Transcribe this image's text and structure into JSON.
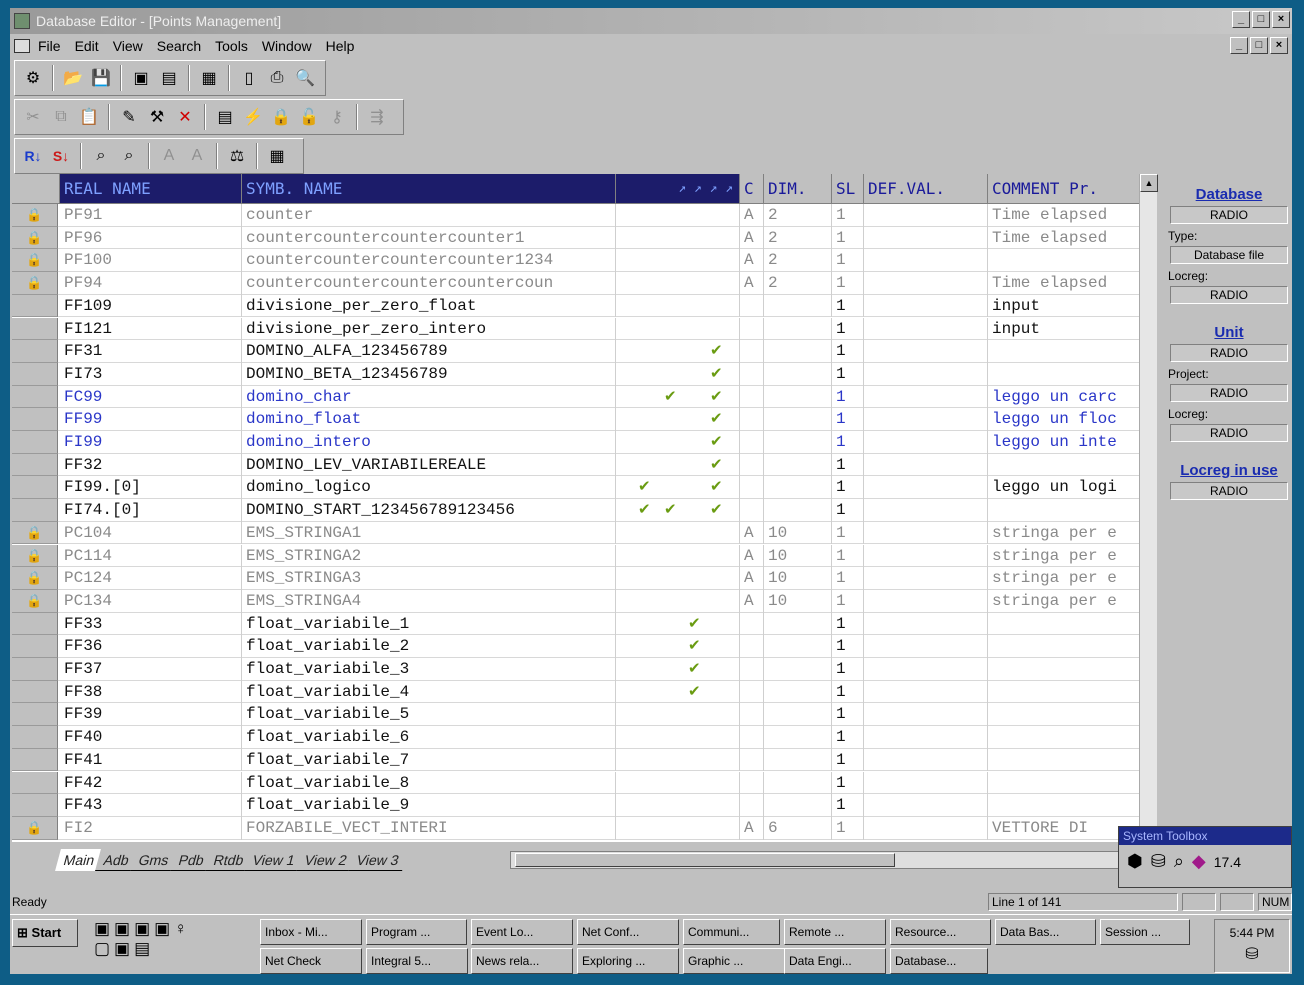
{
  "window": {
    "title": "Database Editor - [Points Management]",
    "buttons": [
      "_",
      "□",
      "×"
    ]
  },
  "menu": [
    "File",
    "Edit",
    "View",
    "Search",
    "Tools",
    "Window",
    "Help"
  ],
  "columns": {
    "real_name": "REAL NAME",
    "symb_name": "SYMB. NAME",
    "flags": "↗ ↗ ↗ ↗",
    "c": "C",
    "dim": "DIM.",
    "sl": "SL",
    "def_val": "DEF.VAL.",
    "comment": "COMMENT Pr."
  },
  "rows": [
    {
      "real": "PF91",
      "symb": "counter",
      "c": "A",
      "dim": "2",
      "sl": "1",
      "comment": "Time elapsed",
      "style": "gray",
      "rowicon": true
    },
    {
      "real": "PF96",
      "symb": "countercountercountercounter1",
      "c": "A",
      "dim": "2",
      "sl": "1",
      "comment": "Time elapsed",
      "style": "gray",
      "rowicon": true
    },
    {
      "real": "PF100",
      "symb": "countercountercountercounter1234",
      "c": "A",
      "dim": "2",
      "sl": "1",
      "comment": "",
      "style": "gray",
      "rowicon": true
    },
    {
      "real": "PF94",
      "symb": "countercountercountercountercoun",
      "c": "A",
      "dim": "2",
      "sl": "1",
      "comment": "Time elapsed",
      "style": "gray",
      "rowicon": true
    },
    {
      "real": "FF109",
      "symb": "divisione_per_zero_float",
      "c": "",
      "dim": "",
      "sl": "1",
      "comment": "input",
      "style": "blk"
    },
    {
      "real": "FI121",
      "symb": "divisione_per_zero_intero",
      "c": "",
      "dim": "",
      "sl": "1",
      "comment": "input",
      "style": "blk"
    },
    {
      "real": "FF31",
      "symb": "DOMINO_ALFA_123456789",
      "c": "",
      "dim": "",
      "sl": "1",
      "comment": "",
      "style": "blk",
      "checks": [
        4
      ]
    },
    {
      "real": "FI73",
      "symb": "DOMINO_BETA_123456789",
      "c": "",
      "dim": "",
      "sl": "1",
      "comment": "",
      "style": "blk",
      "checks": [
        4
      ]
    },
    {
      "real": "FC99",
      "symb": "domino_char",
      "c": "",
      "dim": "",
      "sl": "1",
      "comment": "leggo un carc",
      "style": "blue",
      "checks": [
        2,
        4
      ]
    },
    {
      "real": "FF99",
      "symb": "domino_float",
      "c": "",
      "dim": "",
      "sl": "1",
      "comment": "leggo un floc",
      "style": "blue",
      "checks": [
        4
      ]
    },
    {
      "real": "FI99",
      "symb": "domino_intero",
      "c": "",
      "dim": "",
      "sl": "1",
      "comment": "leggo un inte",
      "style": "blue",
      "checks": [
        4
      ]
    },
    {
      "real": "FF32",
      "symb": "DOMINO_LEV_VARIABILEREALE",
      "c": "",
      "dim": "",
      "sl": "1",
      "comment": "",
      "style": "blk",
      "checks": [
        4
      ]
    },
    {
      "real": "FI99.[0]",
      "symb": "domino_logico",
      "c": "",
      "dim": "",
      "sl": "1",
      "comment": "leggo un logi",
      "style": "blk",
      "checks": [
        1,
        4
      ]
    },
    {
      "real": "FI74.[0]",
      "symb": "DOMINO_START_123456789123456",
      "c": "",
      "dim": "",
      "sl": "1",
      "comment": "",
      "style": "blk",
      "checks": [
        1,
        2,
        4
      ]
    },
    {
      "real": "PC104",
      "symb": "EMS_STRINGA1",
      "c": "A",
      "dim": "10",
      "sl": "1",
      "comment": "stringa per e",
      "style": "gray",
      "rowicon": true
    },
    {
      "real": "PC114",
      "symb": "EMS_STRINGA2",
      "c": "A",
      "dim": "10",
      "sl": "1",
      "comment": "stringa per e",
      "style": "gray",
      "rowicon": true
    },
    {
      "real": "PC124",
      "symb": "EMS_STRINGA3",
      "c": "A",
      "dim": "10",
      "sl": "1",
      "comment": "stringa per e",
      "style": "gray",
      "rowicon": true
    },
    {
      "real": "PC134",
      "symb": "EMS_STRINGA4",
      "c": "A",
      "dim": "10",
      "sl": "1",
      "comment": "stringa per e",
      "style": "gray",
      "rowicon": true
    },
    {
      "real": "FF33",
      "symb": "float_variabile_1",
      "c": "",
      "dim": "",
      "sl": "1",
      "comment": "",
      "style": "blk",
      "checks": [
        3
      ]
    },
    {
      "real": "FF36",
      "symb": "float_variabile_2",
      "c": "",
      "dim": "",
      "sl": "1",
      "comment": "",
      "style": "blk",
      "checks": [
        3
      ]
    },
    {
      "real": "FF37",
      "symb": "float_variabile_3",
      "c": "",
      "dim": "",
      "sl": "1",
      "comment": "",
      "style": "blk",
      "checks": [
        3
      ]
    },
    {
      "real": "FF38",
      "symb": "float_variabile_4",
      "c": "",
      "dim": "",
      "sl": "1",
      "comment": "",
      "style": "blk",
      "checks": [
        3
      ]
    },
    {
      "real": "FF39",
      "symb": "float_variabile_5",
      "c": "",
      "dim": "",
      "sl": "1",
      "comment": "",
      "style": "blk"
    },
    {
      "real": "FF40",
      "symb": "float_variabile_6",
      "c": "",
      "dim": "",
      "sl": "1",
      "comment": "",
      "style": "blk"
    },
    {
      "real": "FF41",
      "symb": "float_variabile_7",
      "c": "",
      "dim": "",
      "sl": "1",
      "comment": "",
      "style": "blk"
    },
    {
      "real": "FF42",
      "symb": "float_variabile_8",
      "c": "",
      "dim": "",
      "sl": "1",
      "comment": "",
      "style": "blk"
    },
    {
      "real": "FF43",
      "symb": "float_variabile_9",
      "c": "",
      "dim": "",
      "sl": "1",
      "comment": "",
      "style": "blk"
    },
    {
      "real": "FI2",
      "symb": "FORZABILE_VECT_INTERI",
      "c": "A",
      "dim": "6",
      "sl": "1",
      "comment": "VETTORE DI",
      "style": "gray",
      "rowicon": true
    }
  ],
  "side_panel": {
    "database_link": "Database",
    "database_value": "RADIO",
    "type_label": "Type:",
    "type_value": "Database file",
    "locreg_label": "Locreg:",
    "locreg_value": "RADIO",
    "unit_link": "Unit",
    "unit_value": "RADIO",
    "project_label": "Project:",
    "project_value": "RADIO",
    "locreg2_label": "Locreg:",
    "locreg2_value": "RADIO",
    "locreg_in_use_link": "Locreg in use",
    "locreg_in_use_value": "RADIO"
  },
  "tabs": [
    "Main",
    "Adb",
    "Gms",
    "Pdb",
    "Rtdb",
    "View 1",
    "View 2",
    "View 3"
  ],
  "toolbox": {
    "title": "System Toolbox",
    "value": "17.4"
  },
  "status": {
    "text": "Ready",
    "line": "Line 1 of 141",
    "num": "NUM"
  },
  "taskbar": {
    "start": "Start",
    "row1": [
      "Inbox - Mi...",
      "Program ...",
      "Event Lo...",
      "Net Conf...",
      "Communi...",
      "Remote ...",
      "Resource...",
      "Data Bas...",
      "Session ..."
    ],
    "row2": [
      "Net Check",
      "Integral 5...",
      "News rela...",
      "Exploring ...",
      "Graphic ...",
      "Data Engi...",
      "Database..."
    ],
    "clock": "5:44 PM"
  }
}
